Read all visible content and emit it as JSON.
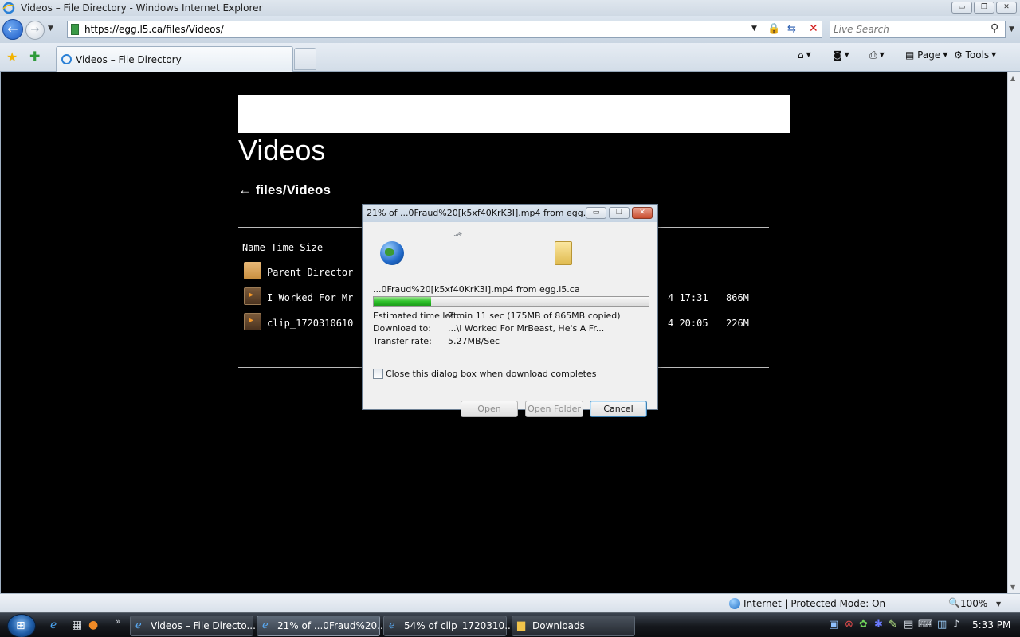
{
  "window": {
    "title": "Videos – File Directory - Windows Internet Explorer",
    "minimize": "▭",
    "restore": "❐",
    "close": "✕"
  },
  "address": {
    "url": "https://egg.l5.ca/files/Videos/",
    "search_placeholder": "Live Search"
  },
  "tabs": [
    {
      "label": "Videos – File Directory"
    }
  ],
  "commands": {
    "page": "Page",
    "tools": "Tools"
  },
  "page": {
    "heading": "Videos",
    "breadcrumb": "← files/Videos",
    "column_headers": "Name Time Size",
    "rows": [
      {
        "name": "Parent Director",
        "time": "",
        "size": ""
      },
      {
        "name": "I Worked For Mr",
        "time": "4 17:31",
        "size": "866M"
      },
      {
        "name": "clip_1720310610",
        "time": "4 20:05",
        "size": "226M"
      }
    ]
  },
  "dialog": {
    "title": "21% of ...0Fraud%20[k5xf40KrK3I].mp4 from egg.l...",
    "filename": "...0Fraud%20[k5xf40KrK3I].mp4 from egg.l5.ca",
    "progress_fraction": 0.21,
    "estimated_label": "Estimated time left:",
    "estimated_value": "2 min 11 sec (175MB of 865MB copied)",
    "download_to_label": "Download to:",
    "download_to_value": "...\\I Worked For MrBeast, He's A Fr...",
    "rate_label": "Transfer rate:",
    "rate_value": "5.27MB/Sec",
    "close_checkbox_label": "Close this dialog box when download completes",
    "open_label": "Open",
    "open_folder_label": "Open Folder",
    "cancel_label": "Cancel"
  },
  "status": {
    "zone": "Internet | Protected Mode: On",
    "zoom": "100%"
  },
  "taskbar": {
    "tasks": [
      {
        "label": "Videos – File Directo..."
      },
      {
        "label": "21% of ...0Fraud%20..."
      },
      {
        "label": "54% of clip_1720310..."
      },
      {
        "label": "Downloads"
      }
    ],
    "clock": "5:33 PM"
  }
}
